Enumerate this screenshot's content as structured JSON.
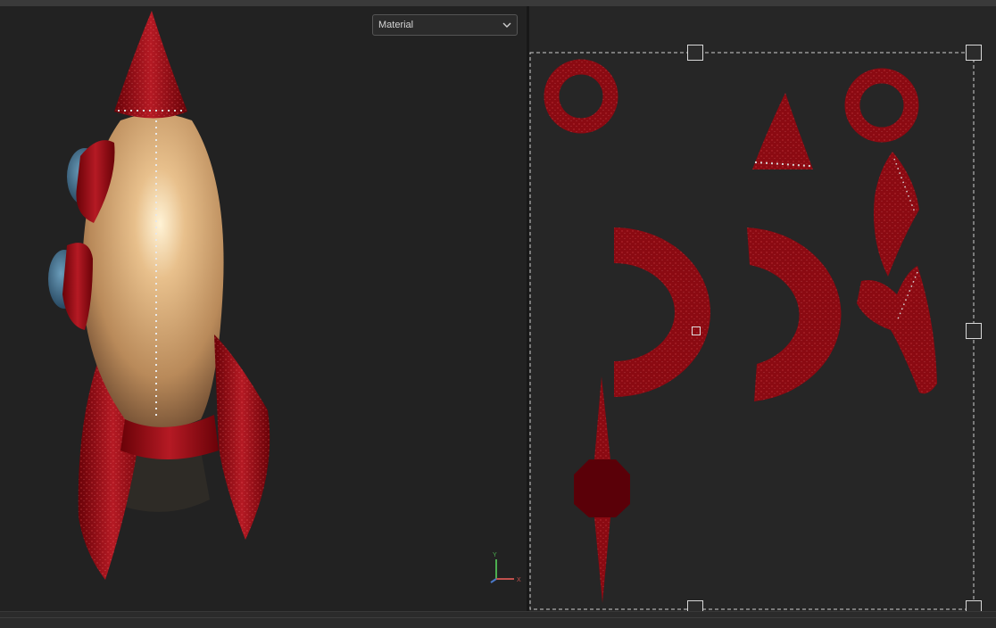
{
  "viewport": {
    "display_mode_dropdown": {
      "selected": "Material",
      "icon": "chevron-down-icon"
    },
    "axis_gizmo": {
      "y_label": "Y",
      "x_label": "X",
      "icon": "axis-gizmo-icon"
    },
    "model": "rocket-model"
  },
  "uv_editor": {
    "islands": [
      "ring-island-left",
      "nose-cone-island",
      "ring-island-right",
      "fin-island-upper-right",
      "half-ring-island-left",
      "half-ring-island-middle",
      "fin-island-right",
      "spike-island"
    ]
  },
  "colors": {
    "background": "#1f1f1f",
    "viewport_bg": "#222222",
    "uv_bg": "#262626",
    "texture_red": "#8b0a12",
    "body_cream": "#d9b080",
    "axis_y": "#4caf50",
    "axis_x": "#c0504d"
  }
}
